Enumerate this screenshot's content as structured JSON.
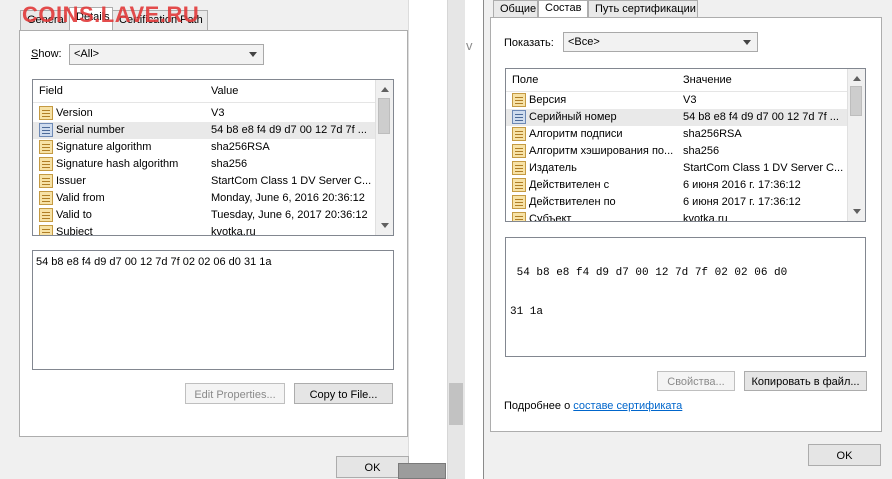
{
  "left": {
    "tabs": [
      "General",
      "Details",
      "Certification Path"
    ],
    "show_label": "Show:",
    "show_value": "<All>",
    "columns": [
      "Field",
      "Value"
    ],
    "rows": [
      {
        "field": "Version",
        "value": "V3"
      },
      {
        "field": "Serial number",
        "value": "54 b8 e8 f4 d9 d7 00 12 7d 7f ..."
      },
      {
        "field": "Signature algorithm",
        "value": "sha256RSA"
      },
      {
        "field": "Signature hash algorithm",
        "value": "sha256"
      },
      {
        "field": "Issuer",
        "value": "StartCom Class 1 DV Server C..."
      },
      {
        "field": "Valid from",
        "value": "Monday, June 6, 2016 20:36:12"
      },
      {
        "field": "Valid to",
        "value": "Tuesday, June 6, 2017 20:36:12"
      },
      {
        "field": "Subject",
        "value": "kvotka.ru"
      }
    ],
    "selected_row": 1,
    "detail_value": "54 b8 e8 f4 d9 d7 00 12 7d 7f 02 02 06 d0 31 1a",
    "edit_properties": "Edit Properties...",
    "copy_to_file": "Copy to File...",
    "ok": "OK"
  },
  "right": {
    "tabs": [
      "Общие",
      "Состав",
      "Путь сертификации"
    ],
    "show_label": "Показать:",
    "show_value": "<Все>",
    "columns": [
      "Поле",
      "Значение"
    ],
    "rows": [
      {
        "field": "Версия",
        "value": "V3"
      },
      {
        "field": "Серийный номер",
        "value": "54 b8 e8 f4 d9 d7 00 12 7d 7f ..."
      },
      {
        "field": "Алгоритм подписи",
        "value": "sha256RSA"
      },
      {
        "field": "Алгоритм хэширования по...",
        "value": "sha256"
      },
      {
        "field": "Издатель",
        "value": "StartCom Class 1 DV Server C..."
      },
      {
        "field": "Действителен с",
        "value": "6 июня 2016 г. 17:36:12"
      },
      {
        "field": "Действителен по",
        "value": "6 июня 2017 г. 17:36:12"
      },
      {
        "field": "Субъект",
        "value": "kvotka.ru"
      }
    ],
    "selected_row": 1,
    "detail_line1": " 54 b8 e8 f4 d9 d7 00 12 7d 7f 02 02 06 d0",
    "detail_line2": "31 1a",
    "properties": "Свойства...",
    "copy_to_file": "Копировать в файл...",
    "more_prefix": "Подробнее о",
    "more_link": "составе сертификата",
    "ok": "OK"
  },
  "watermark": "COINS.LAVE.RU",
  "stray_glyph": "v"
}
